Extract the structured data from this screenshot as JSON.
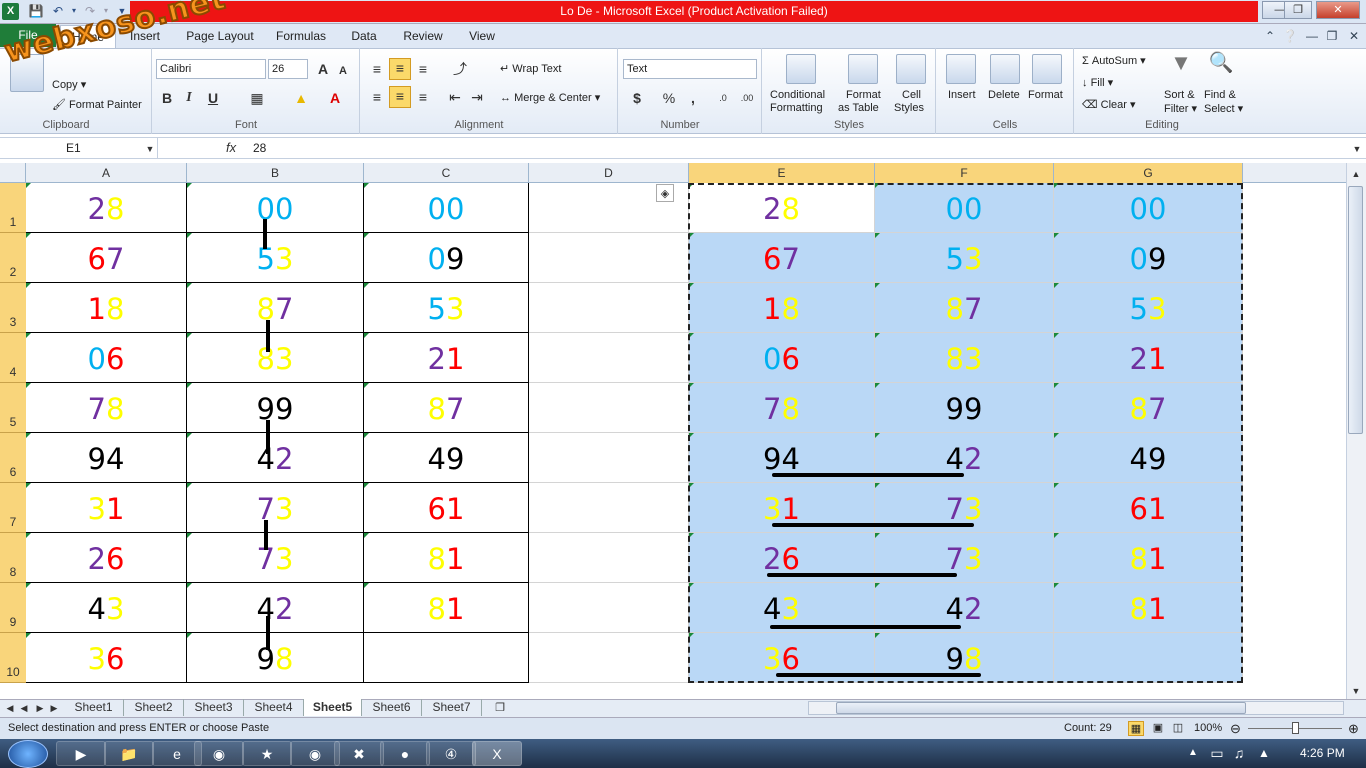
{
  "window": {
    "title": "Lo De  -  Microsoft Excel (Product Activation Failed)"
  },
  "watermark": "webxoso.net",
  "tabs": [
    "File",
    "Home",
    "Insert",
    "Page Layout",
    "Formulas",
    "Data",
    "Review",
    "View"
  ],
  "ribbon": {
    "clipboard": {
      "label": "Clipboard",
      "copy": "Copy",
      "format_painter": "Format Painter"
    },
    "font": {
      "label": "Font",
      "name": "Calibri",
      "size": "26"
    },
    "alignment": {
      "label": "Alignment",
      "wrap": "Wrap Text",
      "merge": "Merge & Center"
    },
    "number": {
      "label": "Number",
      "format": "Text"
    },
    "styles": {
      "label": "Styles",
      "conditional": "Conditional",
      "conditional2": "Formatting",
      "format_table": "Format",
      "format_table2": "as Table",
      "cell_styles": "Cell",
      "cell_styles2": "Styles"
    },
    "cells": {
      "label": "Cells",
      "insert": "Insert",
      "delete": "Delete",
      "format": "Format"
    },
    "editing": {
      "label": "Editing",
      "autosum": "AutoSum",
      "fill": "Fill",
      "clear": "Clear",
      "sort": "Sort &",
      "sort2": "Filter",
      "find": "Find &",
      "find2": "Select"
    }
  },
  "formula_bar": {
    "name_box": "E1",
    "fx": "fx",
    "value": "28"
  },
  "columns": [
    "A",
    "B",
    "C",
    "D",
    "E",
    "F",
    "G"
  ],
  "rows": [
    "1",
    "2",
    "3",
    "4",
    "5",
    "6",
    "7",
    "8",
    "9",
    "10"
  ],
  "colors": {
    "purple": "#7030a0",
    "yellow": "#ffff00",
    "cyan": "#00b0f0",
    "red": "#ff0000",
    "black": "#000000"
  },
  "cells": {
    "A": [
      [
        "2",
        "purple",
        "8",
        "yellow"
      ],
      [
        "6",
        "red",
        "7",
        "purple"
      ],
      [
        "1",
        "red",
        "8",
        "yellow"
      ],
      [
        "0",
        "cyan",
        "6",
        "red"
      ],
      [
        "7",
        "purple",
        "8",
        "yellow"
      ],
      [
        "9",
        "black",
        "4",
        "black"
      ],
      [
        "3",
        "yellow",
        "1",
        "red"
      ],
      [
        "2",
        "purple",
        "6",
        "red"
      ],
      [
        "4",
        "black",
        "3",
        "yellow"
      ],
      [
        "3",
        "yellow",
        "6",
        "red"
      ]
    ],
    "B": [
      [
        "0",
        "cyan",
        "0",
        "cyan"
      ],
      [
        "5",
        "cyan",
        "3",
        "yellow"
      ],
      [
        "8",
        "yellow",
        "7",
        "purple"
      ],
      [
        "8",
        "yellow",
        "3",
        "yellow"
      ],
      [
        "9",
        "black",
        "9",
        "black"
      ],
      [
        "4",
        "black",
        "2",
        "purple"
      ],
      [
        "7",
        "purple",
        "3",
        "yellow"
      ],
      [
        "7",
        "purple",
        "3",
        "yellow"
      ],
      [
        "4",
        "black",
        "2",
        "purple"
      ],
      [
        "9",
        "black",
        "8",
        "yellow"
      ]
    ],
    "C": [
      [
        "0",
        "cyan",
        "0",
        "cyan"
      ],
      [
        "0",
        "cyan",
        "9",
        "black"
      ],
      [
        "5",
        "cyan",
        "3",
        "yellow"
      ],
      [
        "2",
        "purple",
        "1",
        "red"
      ],
      [
        "8",
        "yellow",
        "7",
        "purple"
      ],
      [
        "4",
        "black",
        "9",
        "black"
      ],
      [
        "6",
        "red",
        "1",
        "red"
      ],
      [
        "8",
        "yellow",
        "1",
        "red"
      ],
      [
        "8",
        "yellow",
        "1",
        "red"
      ],
      [
        "",
        "black",
        "",
        "black"
      ]
    ],
    "E": [
      [
        "2",
        "purple",
        "8",
        "yellow"
      ],
      [
        "6",
        "red",
        "7",
        "purple"
      ],
      [
        "1",
        "red",
        "8",
        "yellow"
      ],
      [
        "0",
        "cyan",
        "6",
        "red"
      ],
      [
        "7",
        "purple",
        "8",
        "yellow"
      ],
      [
        "9",
        "black",
        "4",
        "black"
      ],
      [
        "3",
        "yellow",
        "1",
        "red"
      ],
      [
        "2",
        "purple",
        "6",
        "red"
      ],
      [
        "4",
        "black",
        "3",
        "yellow"
      ],
      [
        "3",
        "yellow",
        "6",
        "red"
      ]
    ],
    "F": [
      [
        "0",
        "cyan",
        "0",
        "cyan"
      ],
      [
        "5",
        "cyan",
        "3",
        "yellow"
      ],
      [
        "8",
        "yellow",
        "7",
        "purple"
      ],
      [
        "8",
        "yellow",
        "3",
        "yellow"
      ],
      [
        "9",
        "black",
        "9",
        "black"
      ],
      [
        "4",
        "black",
        "2",
        "purple"
      ],
      [
        "7",
        "purple",
        "3",
        "yellow"
      ],
      [
        "7",
        "purple",
        "3",
        "yellow"
      ],
      [
        "4",
        "black",
        "2",
        "purple"
      ],
      [
        "9",
        "black",
        "8",
        "yellow"
      ]
    ],
    "G": [
      [
        "0",
        "cyan",
        "0",
        "cyan"
      ],
      [
        "0",
        "cyan",
        "9",
        "black"
      ],
      [
        "5",
        "cyan",
        "3",
        "yellow"
      ],
      [
        "2",
        "purple",
        "1",
        "red"
      ],
      [
        "8",
        "yellow",
        "7",
        "purple"
      ],
      [
        "4",
        "black",
        "9",
        "black"
      ],
      [
        "6",
        "red",
        "1",
        "red"
      ],
      [
        "8",
        "yellow",
        "1",
        "red"
      ],
      [
        "8",
        "yellow",
        "1",
        "red"
      ],
      [
        "",
        "black",
        "",
        "black"
      ]
    ]
  },
  "sheets": [
    "Sheet1",
    "Sheet2",
    "Sheet3",
    "Sheet4",
    "Sheet5",
    "Sheet6",
    "Sheet7"
  ],
  "active_sheet": "Sheet5",
  "status": {
    "message": "Select destination and press ENTER or choose Paste",
    "count": "Count: 29",
    "zoom": "100%"
  },
  "taskbar": {
    "time": "4:26 PM"
  }
}
